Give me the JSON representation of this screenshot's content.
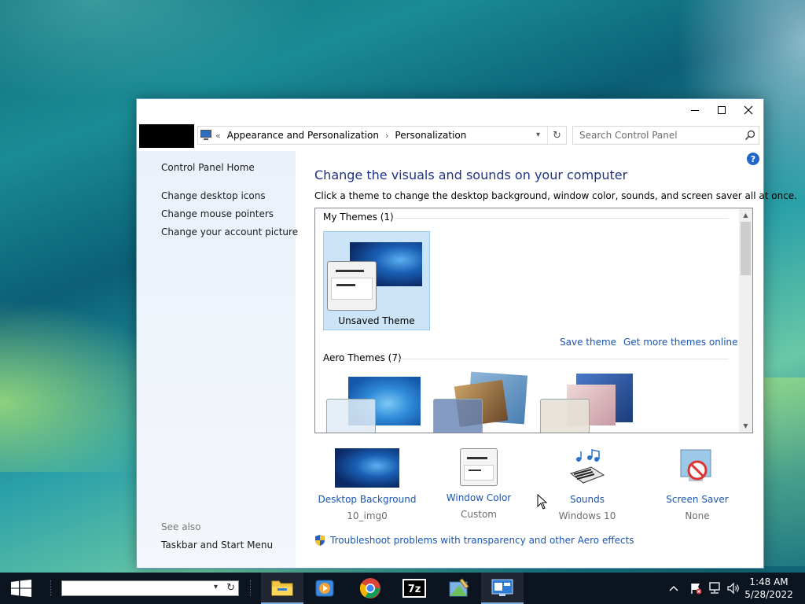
{
  "window": {
    "address": {
      "chevron": "«",
      "crumbs": [
        "Appearance and Personalization",
        "Personalization"
      ],
      "separator": "›"
    },
    "search_placeholder": "Search Control Panel",
    "sidebar": {
      "home": "Control Panel Home",
      "links": [
        "Change desktop icons",
        "Change mouse pointers",
        "Change your account picture"
      ],
      "see_also": "See also",
      "see_also_links": [
        "Taskbar and Start Menu"
      ]
    },
    "help": "?",
    "title": "Change the visuals and sounds on your computer",
    "subtitle": "Click a theme to change the desktop background, window color, sounds, and screen saver all at once.",
    "my_themes": {
      "heading": "My Themes (1)",
      "themes": [
        {
          "label": "Unsaved Theme",
          "selected": true
        }
      ],
      "save_link": "Save theme",
      "more_link": "Get more themes online"
    },
    "aero_themes": {
      "heading": "Aero Themes (7)"
    },
    "options": [
      {
        "label": "Desktop Background",
        "value": "10_img0",
        "icon": "desktop-background-icon"
      },
      {
        "label": "Window Color",
        "value": "Custom",
        "icon": "window-color-icon"
      },
      {
        "label": "Sounds",
        "value": "Windows 10",
        "icon": "sounds-icon"
      },
      {
        "label": "Screen Saver",
        "value": "None",
        "icon": "screen-saver-icon"
      }
    ],
    "troubleshoot": "Troubleshoot problems with transparency and other Aero effects"
  },
  "taskbar": {
    "apps": [
      "file-explorer",
      "media-player",
      "chrome",
      "7-zip",
      "control-panel-tool",
      "personalization"
    ],
    "time": "1:48 AM",
    "date": "5/28/2022"
  },
  "colors": {
    "accent_link": "#1a56b3",
    "title_blue": "#1e3287",
    "selection": "#cce4f7"
  }
}
